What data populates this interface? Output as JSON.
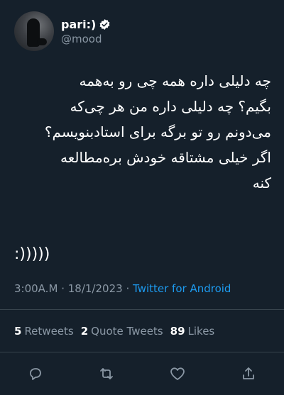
{
  "user": {
    "display_name": "pari:)",
    "handle": "@mood"
  },
  "tweet": {
    "text": "چه دلیلی داره همه چی رو به‌همه\nبگیم؟ چه دلیلی داره من هر چی‌که\nمی‌دونم رو تو برگه برای استادبنویسم؟\nاگر خیلی مشتاقه خودش بره‌مطالعه\nکنه",
    "smiley": ":)))))"
  },
  "meta": {
    "time": "3:00A.M",
    "date": "18/1/2023",
    "separator": "·",
    "source": "Twitter for Android"
  },
  "stats": {
    "retweets_count": "5",
    "retweets_label": "Retweets",
    "quotes_count": "2",
    "quotes_label": "Quote Tweets",
    "likes_count": "89",
    "likes_label": "Likes"
  },
  "colors": {
    "background": "#15202b",
    "accent": "#1d9bf0",
    "muted": "#8b98a5",
    "divider": "#38444d"
  },
  "icons": [
    "verified-badge-icon",
    "reply-icon",
    "retweet-icon",
    "like-icon",
    "share-icon"
  ]
}
